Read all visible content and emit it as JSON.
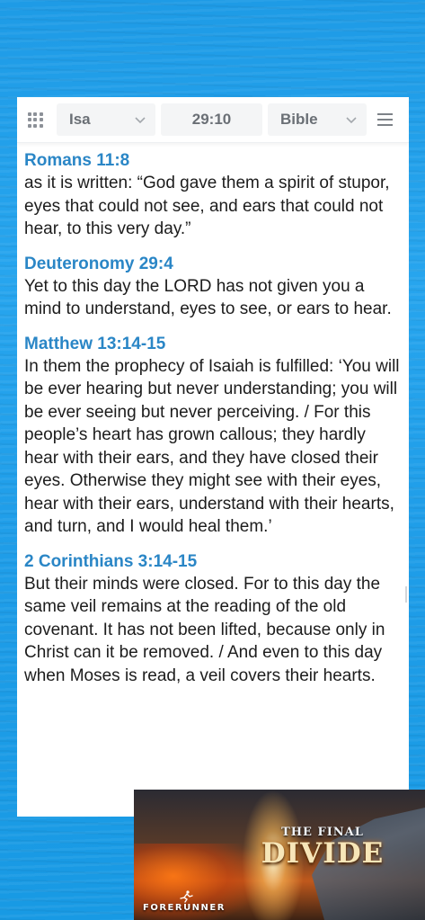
{
  "toolbar": {
    "book": "Isa",
    "reference": "29:10",
    "version": "Bible"
  },
  "entries": [
    {
      "ref": "Romans 11:8",
      "text": "as it is written: “God gave them a spirit of stupor, eyes that could not see, and ears that could not hear, to this very day.”"
    },
    {
      "ref": "Deuteronomy 29:4",
      "text": "Yet to this day the LORD has not given you a mind to understand, eyes to see, or ears to hear."
    },
    {
      "ref": "Matthew 13:14-15",
      "text": "In them the prophecy of Isaiah is fulfilled: ‘You will be ever hearing but never understanding; you will be ever seeing but never perceiving. / For this people’s heart has grown callous; they hardly hear with their ears, and they have closed their eyes. Otherwise they might see with their eyes, hear with their ears, understand with their hearts, and turn, and I would heal them.’"
    },
    {
      "ref": "2 Corinthians 3:14-15",
      "text": "But their minds were closed. For to this day the same veil remains at the reading of the old covenant. It has not been lifted, because only in Christ can it be removed. / And even to this day when Moses is read, a veil covers their hearts."
    }
  ],
  "promo": {
    "title_top": "THE FINAL",
    "title_main": "DIVIDE",
    "brand": "FORERUNNER"
  },
  "colors": {
    "background": "#1f9de8",
    "reference": "#2a86c6",
    "body_text": "#1c1c1c"
  }
}
